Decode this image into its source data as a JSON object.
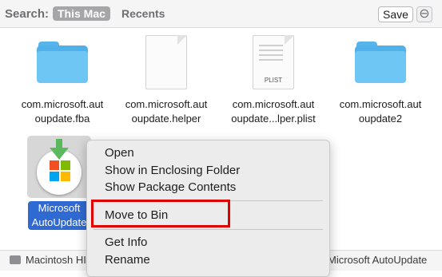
{
  "searchbar": {
    "label": "Search:",
    "scope_this_mac": "This Mac",
    "scope_recents": "Recents",
    "save_label": "Save",
    "remove_symbol": "⊖"
  },
  "files": [
    {
      "name_line1": "com.microsoft.aut",
      "name_line2": "oupdate.fba",
      "icon": "folder-icon"
    },
    {
      "name_line1": "com.microsoft.aut",
      "name_line2": "oupdate.helper",
      "icon": "document-icon"
    },
    {
      "name_line1": "com.microsoft.aut",
      "name_line2": "oupdate...lper.plist",
      "icon": "plist-icon",
      "badge": "PLIST"
    },
    {
      "name_line1": "com.microsoft.aut",
      "name_line2": "oupdate2",
      "icon": "folder-icon"
    }
  ],
  "selected_app": {
    "name_line1": "Microsoft",
    "name_line2": "AutoUpdate",
    "icon": "microsoft-autoupdate-icon",
    "colors": {
      "arrow": "#5cb85c",
      "red": "#f25022",
      "green": "#7fba00",
      "blue": "#00a4ef",
      "yellow": "#ffb900"
    }
  },
  "context_menu": {
    "items": [
      "Open",
      "Show in Enclosing Folder",
      "Show Package Contents",
      "Move to Bin",
      "Get Info",
      "Rename"
    ],
    "highlighted": "Move to Bin",
    "highlight_color": "#e00000"
  },
  "pathbar": {
    "left": "Macintosh HI",
    "right": "Microsoft AutoUpdate"
  }
}
